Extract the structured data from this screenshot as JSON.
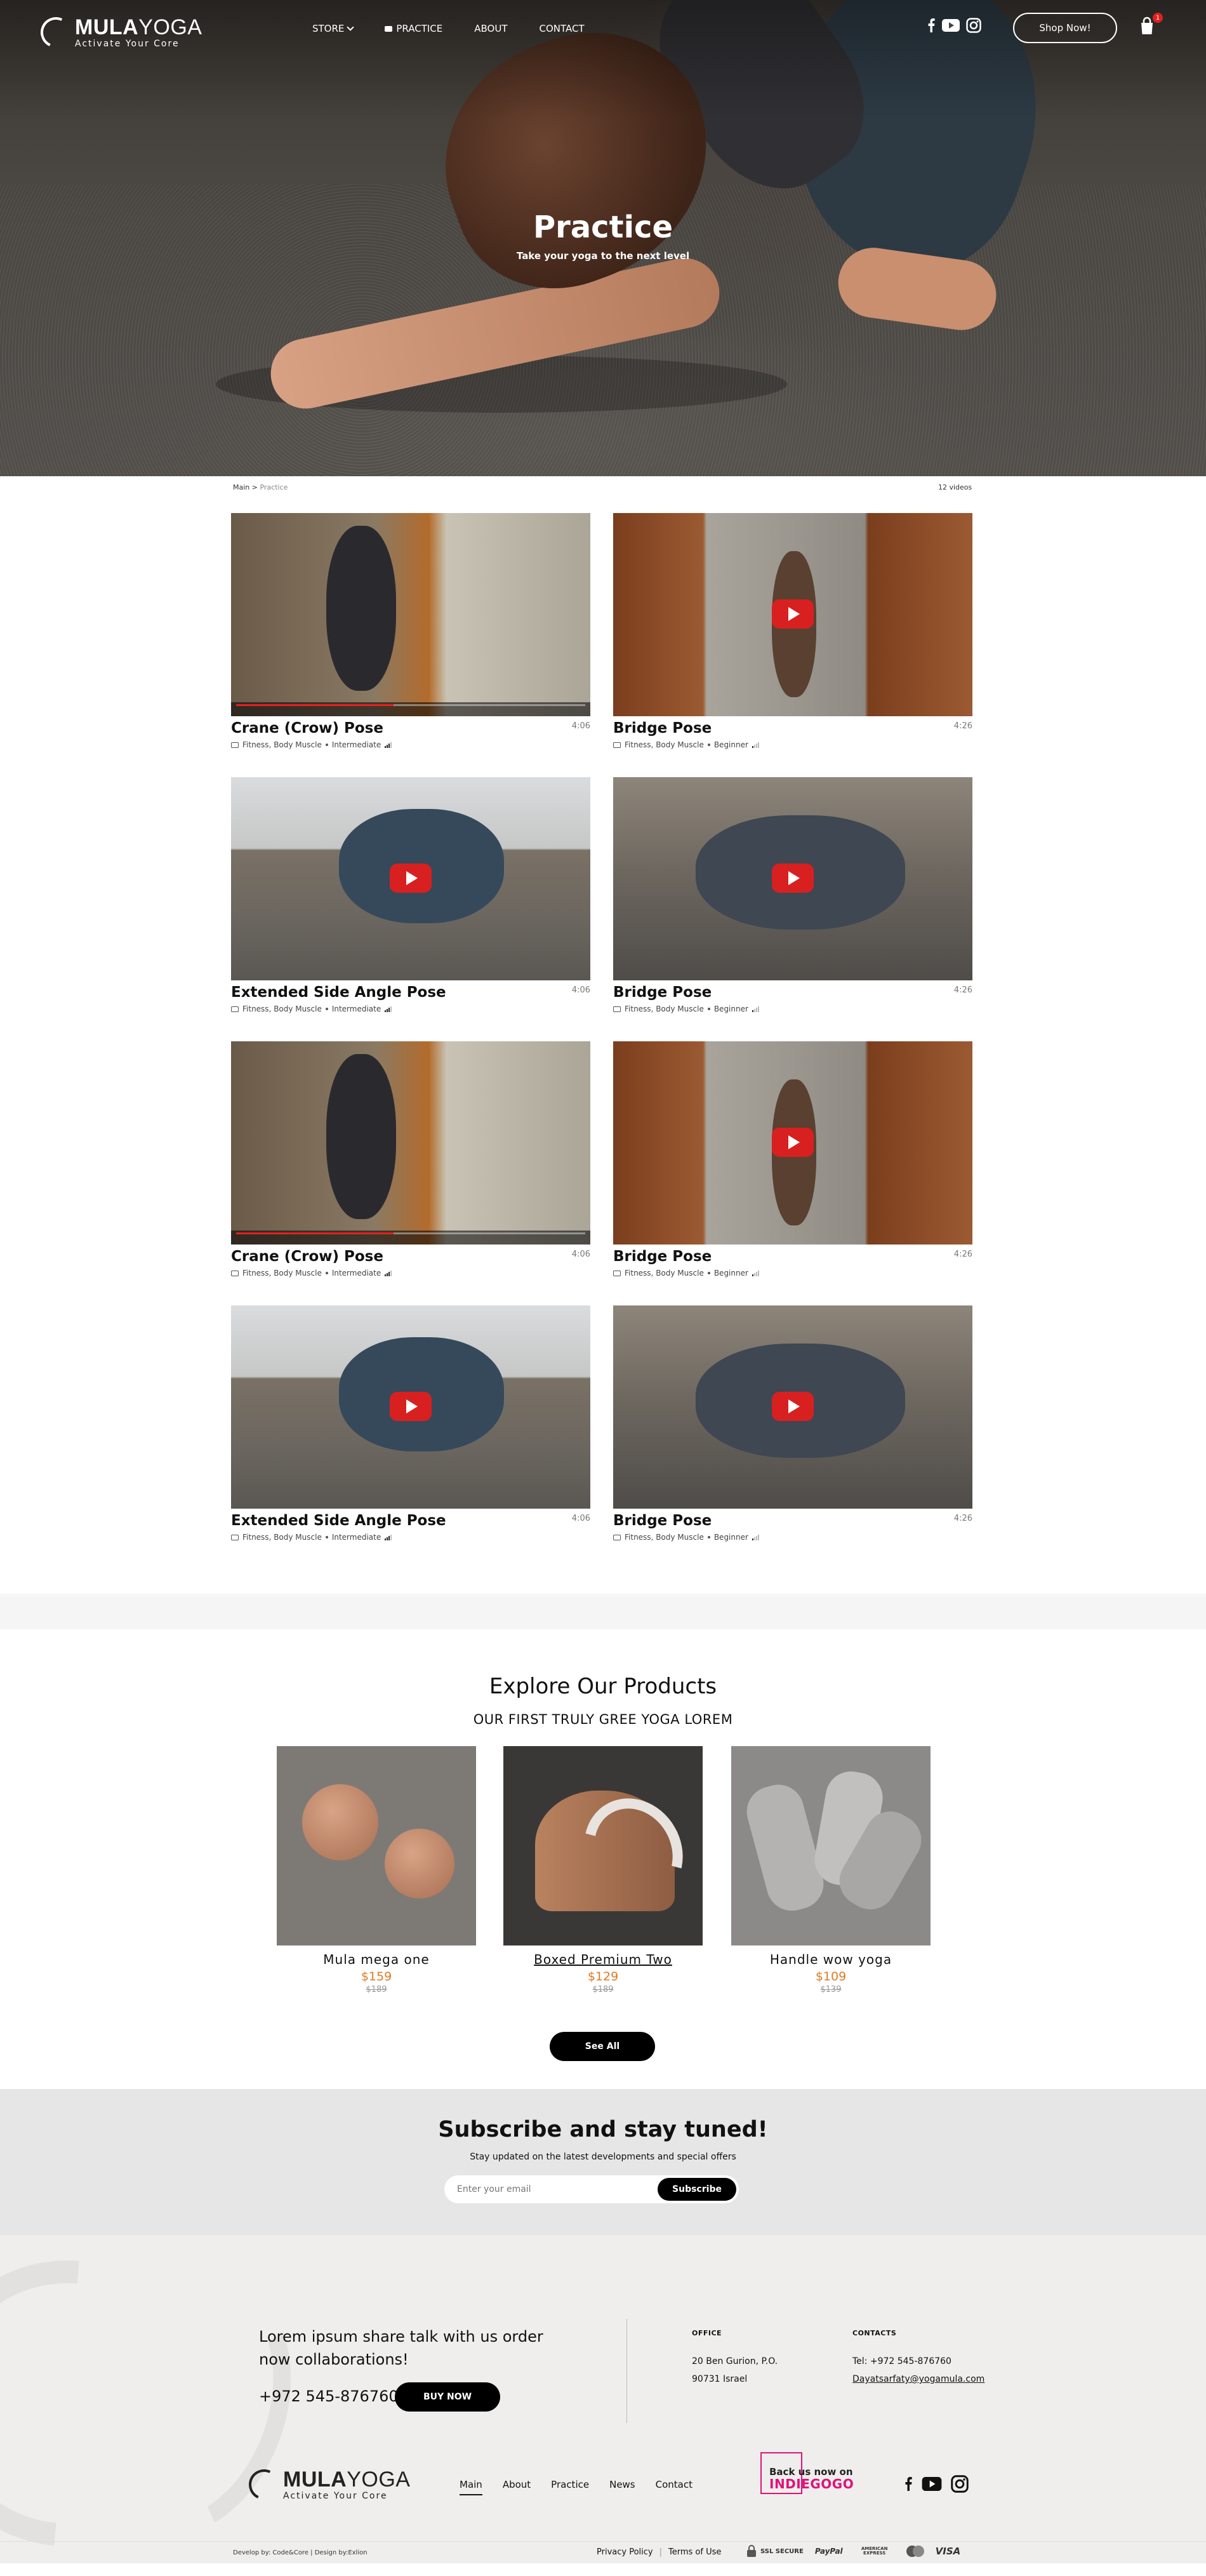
{
  "nav": {
    "logo_bold": "MULA",
    "logo_light": "YOGA",
    "logo_tagline": "Activate Your Core",
    "menu": [
      {
        "label": "STORE"
      },
      {
        "label": "PRACTICE"
      },
      {
        "label": "ABOUT"
      },
      {
        "label": "CONTACT"
      }
    ],
    "shop_button": "Shop Now!",
    "cart_count": "1",
    "social_icons": [
      "facebook-icon",
      "youtube-icon",
      "instagram-icon"
    ]
  },
  "hero": {
    "title": "Practice",
    "subtitle": "Take your yoga to the next level"
  },
  "breadcrumb": {
    "home": "Main",
    "separator": ">",
    "current": "Practice",
    "count": "12 videos"
  },
  "videos": [
    {
      "title": "Crane (Crow) Pose",
      "duration": "4:06",
      "category": "Fitness, Body Muscle",
      "level": "Intermediate",
      "level_bars": 3
    },
    {
      "title": "Bridge Pose",
      "duration": "4:26",
      "category": "Fitness, Body Muscle",
      "level": "Beginner",
      "level_bars": 1
    },
    {
      "title": "Extended Side Angle Pose",
      "duration": "4:06",
      "category": "Fitness, Body Muscle",
      "level": "Intermediate",
      "level_bars": 3
    },
    {
      "title": "Bridge Pose",
      "duration": "4:26",
      "category": "Fitness, Body Muscle",
      "level": "Beginner",
      "level_bars": 1
    },
    {
      "title": "Crane (Crow) Pose",
      "duration": "4:06",
      "category": "Fitness, Body Muscle",
      "level": "Intermediate",
      "level_bars": 3
    },
    {
      "title": "Bridge Pose",
      "duration": "4:26",
      "category": "Fitness, Body Muscle",
      "level": "Beginner",
      "level_bars": 1
    },
    {
      "title": "Extended Side Angle Pose",
      "duration": "4:06",
      "category": "Fitness, Body Muscle",
      "level": "Intermediate",
      "level_bars": 3
    },
    {
      "title": "Bridge Pose",
      "duration": "4:26",
      "category": "Fitness, Body Muscle",
      "level": "Beginner",
      "level_bars": 1
    }
  ],
  "products": {
    "title": "Explore Our Products",
    "subtitle": "OUR FIRST TRULY GREE YOGA LOREM",
    "items": [
      {
        "name": "Mula mega one",
        "price": "$159",
        "old_price": "$189"
      },
      {
        "name": "Boxed Premium Two",
        "price": "$129",
        "old_price": "$189"
      },
      {
        "name": "Handle wow yoga",
        "price": "$109",
        "old_price": "$139"
      }
    ],
    "see_all": "See All"
  },
  "subscribe": {
    "title": "Subscribe and stay tuned!",
    "subtitle": "Stay updated on the latest developments and special offers",
    "placeholder": "Enter your email",
    "button": "Subscribe"
  },
  "footer": {
    "tagline": "Lorem ipsum share talk with us order now collaborations!",
    "phone": "+972 545-876760",
    "buy_now": "BUY NOW",
    "office_heading": "OFFICE",
    "office_line1": "20 Ben Gurion, P.O.",
    "office_line2": "90731 Israel",
    "contacts_heading": "CONTACTS",
    "tel": "Tel: +972 545-876760",
    "email": "Dayatsarfaty@yogamula.com",
    "nav": [
      "Main",
      "About",
      "Practice",
      "News",
      "Contact"
    ],
    "indiegogo_line1": "Back us now on",
    "indiegogo_line2": "INDIEGOGO",
    "credits": "Develop by: Code&Core | Design by:Exlion",
    "privacy": "Privacy Policy",
    "terms": "Terms of Use",
    "ssl": "SSL SECURE",
    "payments": [
      "PayPal",
      "AMERICAN EXPRESS",
      "VISA"
    ]
  },
  "colors": {
    "accent_price": "#e07a24",
    "youtube_red": "#d82020",
    "indiegogo_pink": "#e0127a",
    "footer_bg": "#efeeed",
    "subscribe_bg": "#e6e6e6"
  }
}
